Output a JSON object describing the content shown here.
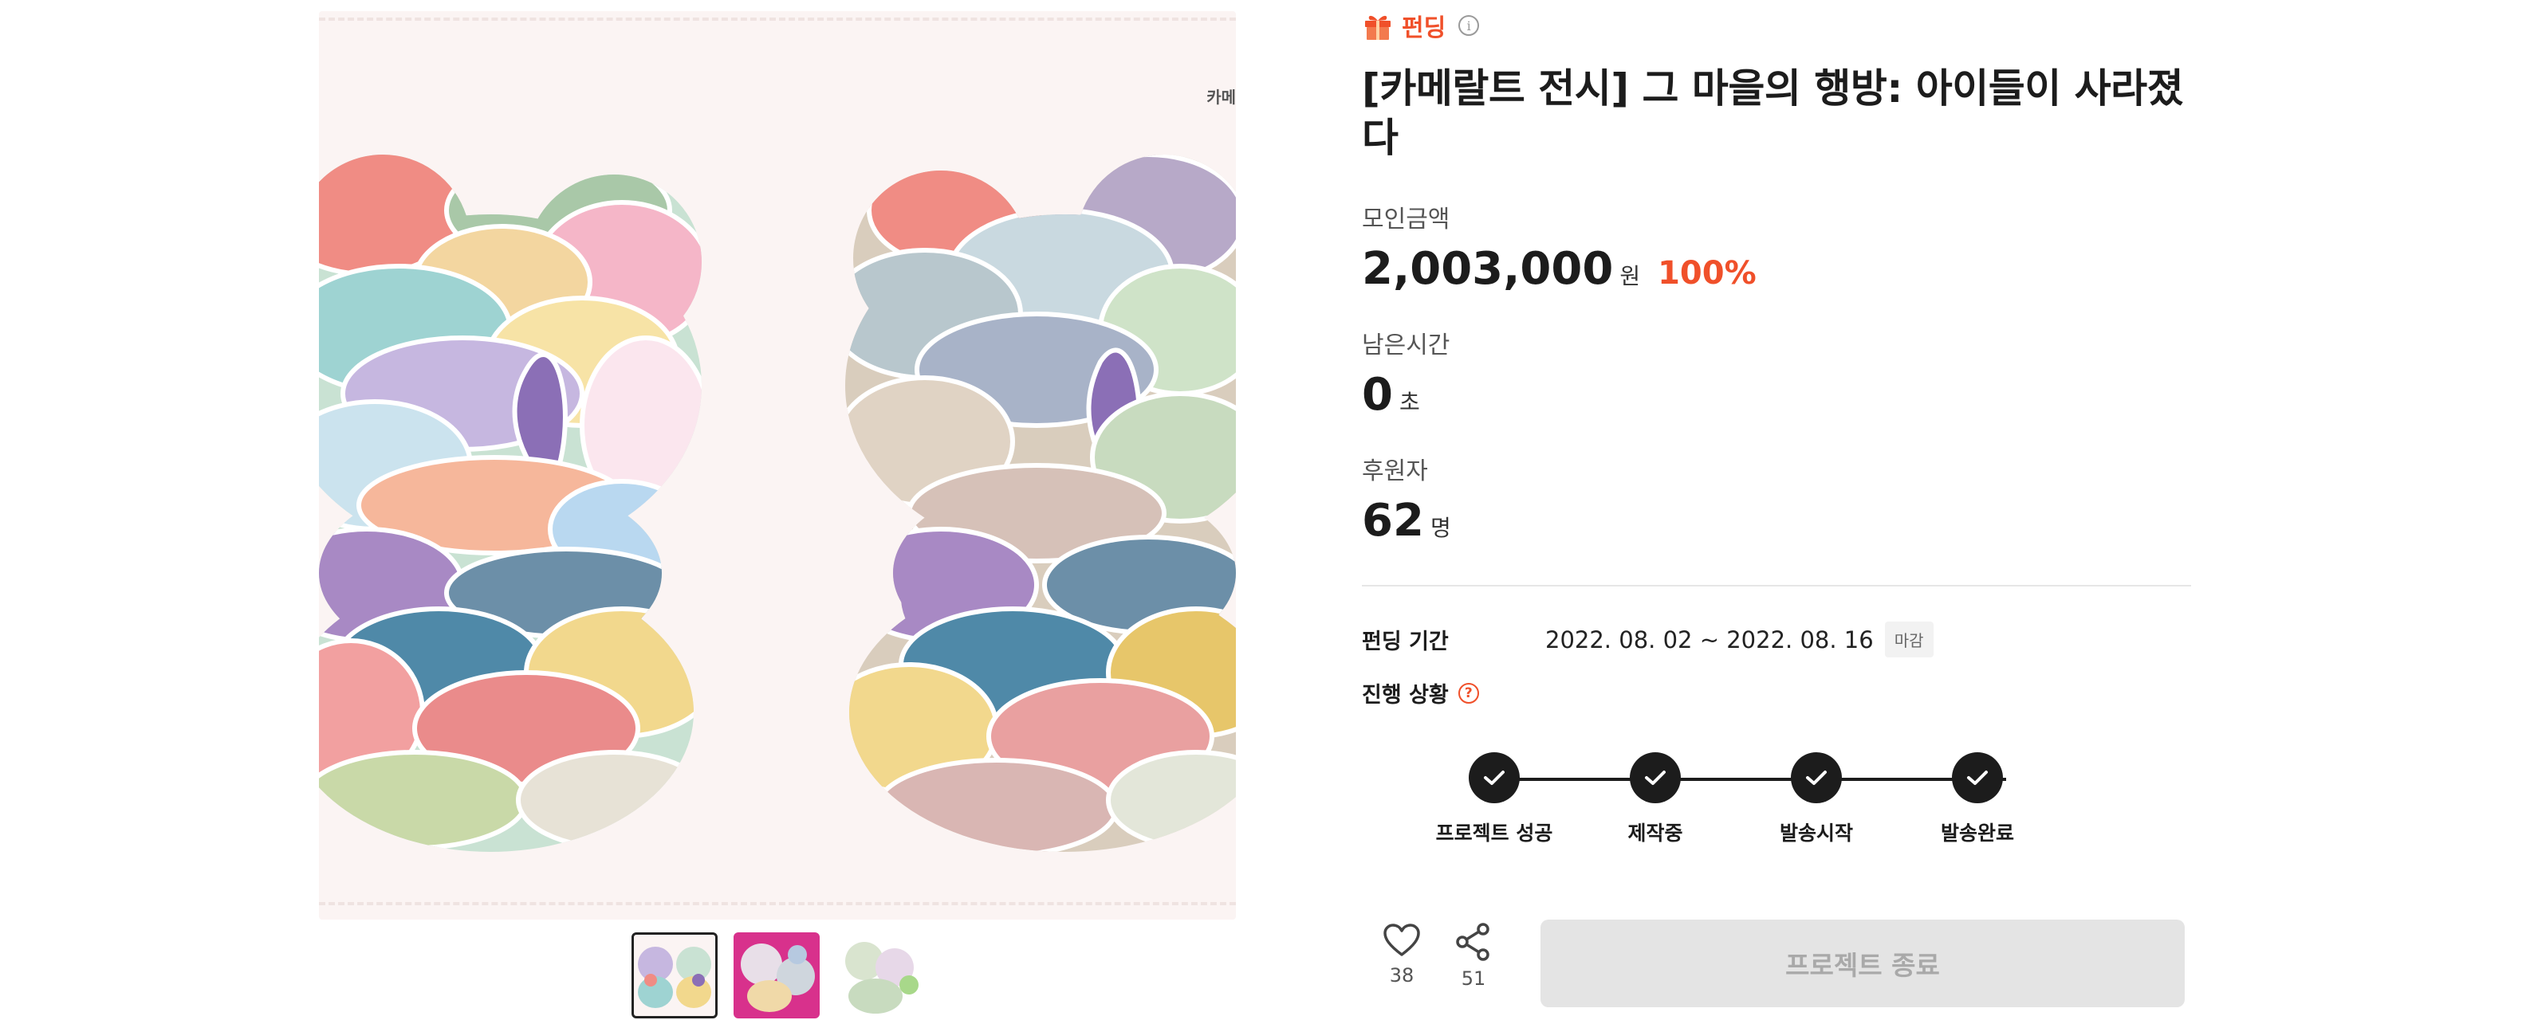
{
  "gallery": {
    "brand_mark": "카메",
    "thumbnails": [
      {
        "name": "thumb-1",
        "active": true
      },
      {
        "name": "thumb-2",
        "active": false
      },
      {
        "name": "thumb-3",
        "active": false
      }
    ]
  },
  "project": {
    "category": "펀딩",
    "category_icon": "gift-icon",
    "title": "[카메랄트 전시] 그 마을의 행방: 아이들이 사라졌다"
  },
  "stats": {
    "amount": {
      "label": "모인금액",
      "value": "2,003,000",
      "unit": "원",
      "percent": "100%"
    },
    "time_left": {
      "label": "남은시간",
      "value": "0",
      "unit": "초"
    },
    "backers": {
      "label": "후원자",
      "value": "62",
      "unit": "명"
    }
  },
  "period": {
    "label": "펀딩 기간",
    "dates": "2022. 08. 02 ~ 2022. 08. 16",
    "badge": "마감"
  },
  "progress": {
    "label": "진행 상황",
    "steps": [
      {
        "label": "프로젝트 성공",
        "done": true
      },
      {
        "label": "제작중",
        "done": true
      },
      {
        "label": "발송시작",
        "done": true
      },
      {
        "label": "발송완료",
        "done": true
      }
    ]
  },
  "actions": {
    "like_count": "38",
    "share_count": "51",
    "end_button_label": "프로젝트 종료"
  },
  "colors": {
    "accent": "#f0502a",
    "text": "#1c1c1c",
    "button_disabled_bg": "#e4e4e4",
    "button_disabled_text": "#a9a9a9"
  }
}
